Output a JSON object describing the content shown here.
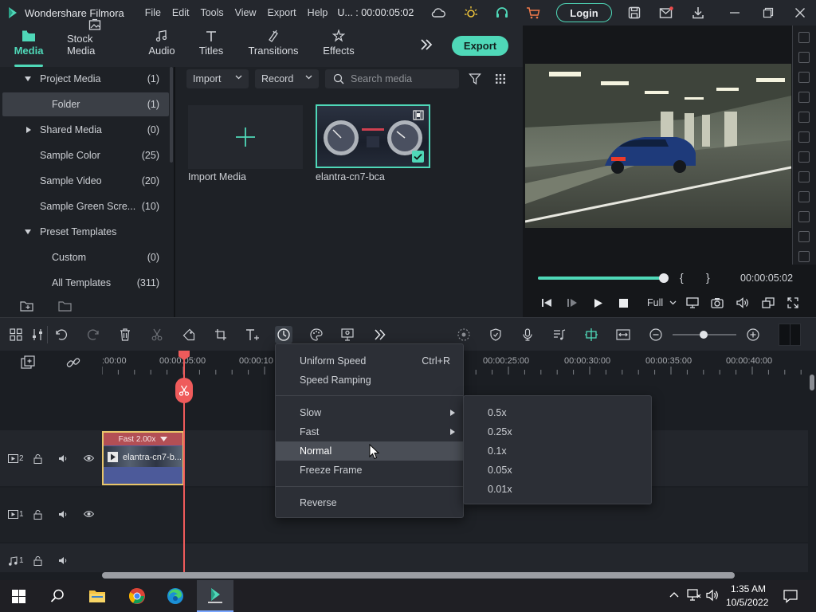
{
  "app": {
    "title": "Wondershare Filmora",
    "menu": [
      "File",
      "Edit",
      "Tools",
      "View",
      "Export",
      "Help"
    ],
    "project_status": "U... : 00:00:05:02",
    "login_label": "Login"
  },
  "media_tabs": [
    {
      "label": "Media",
      "icon": "folder-icon",
      "active": true
    },
    {
      "label": "Stock Media",
      "icon": "stock-media-icon"
    },
    {
      "label": "Audio",
      "icon": "music-note-icon"
    },
    {
      "label": "Titles",
      "icon": "text-icon"
    },
    {
      "label": "Transitions",
      "icon": "transition-icon"
    },
    {
      "label": "Effects",
      "icon": "effects-icon"
    }
  ],
  "export_label": "Export",
  "tree": [
    {
      "label": "Project Media",
      "count": "(1)",
      "expanded": true
    },
    {
      "label": "Folder",
      "count": "(1)",
      "selected": true
    },
    {
      "label": "Shared Media",
      "count": "(0)",
      "expanded": false
    },
    {
      "label": "Sample Color",
      "count": "(25)"
    },
    {
      "label": "Sample Video",
      "count": "(20)"
    },
    {
      "label": "Sample Green Scre...",
      "count": "(10)"
    },
    {
      "label": "Preset Templates",
      "count": "",
      "expanded": true
    },
    {
      "label": "Custom",
      "count": "(0)"
    },
    {
      "label": "All Templates",
      "count": "(311)"
    }
  ],
  "media_toolbar": {
    "import_label": "Import",
    "record_label": "Record",
    "search_placeholder": "Search media"
  },
  "media_items": [
    {
      "label": "Import Media"
    },
    {
      "label": "elantra-cn7-bca"
    }
  ],
  "player": {
    "progress": 1.0,
    "brace_open": "{",
    "brace_close": "}",
    "time": "00:00:05:02",
    "quality": "Full"
  },
  "ruler": [
    ":00:00",
    "00:00:05:00",
    "00:00:10",
    "00:00:25:00",
    "00:00:30:00",
    "00:00:35:00",
    "00:00:40:00"
  ],
  "clip": {
    "speed_label": "Fast 2.00x",
    "name": "elantra-cn7-b..."
  },
  "tracks": [
    {
      "label": "2",
      "type": "video"
    },
    {
      "label": "1",
      "type": "video"
    },
    {
      "label": "1",
      "type": "audio"
    }
  ],
  "speed_menu": {
    "items": [
      {
        "label": "Uniform Speed",
        "shortcut": "Ctrl+R"
      },
      {
        "label": "Speed Ramping"
      },
      {
        "label": "Slow",
        "submenu": true
      },
      {
        "label": "Fast",
        "submenu": true
      },
      {
        "label": "Normal",
        "highlighted": true
      },
      {
        "label": "Freeze Frame"
      },
      {
        "label": "Reverse"
      }
    ],
    "submenu": [
      "0.5x",
      "0.25x",
      "0.1x",
      "0.05x",
      "0.01x"
    ]
  },
  "taskbar": {
    "time": "1:35 AM",
    "date": "10/5/2022"
  },
  "colors": {
    "accent": "#4fd8b8",
    "playhead": "#ef5b5b",
    "clip_border": "#e8c56a"
  }
}
